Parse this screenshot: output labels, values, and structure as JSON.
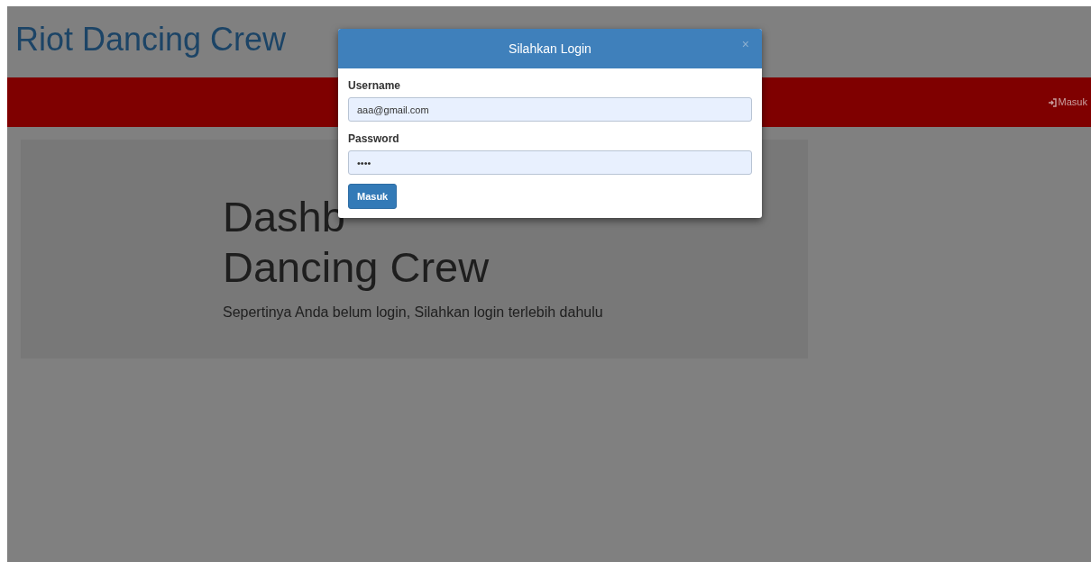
{
  "brand": "Riot Dancing Crew",
  "navbar": {
    "login_link": "Masuk"
  },
  "jumbotron": {
    "heading_lines": [
      "Dashb",
      "Dancing Crew"
    ],
    "text": "Sepertinya Anda belum login, Silahkan login terlebih dahulu"
  },
  "modal": {
    "title": "Silahkan Login",
    "close": "×",
    "fields": [
      {
        "label": "Username",
        "value": "aaa@gmail.com"
      },
      {
        "label": "Password",
        "value": "••••"
      }
    ],
    "submit": "Masuk"
  }
}
